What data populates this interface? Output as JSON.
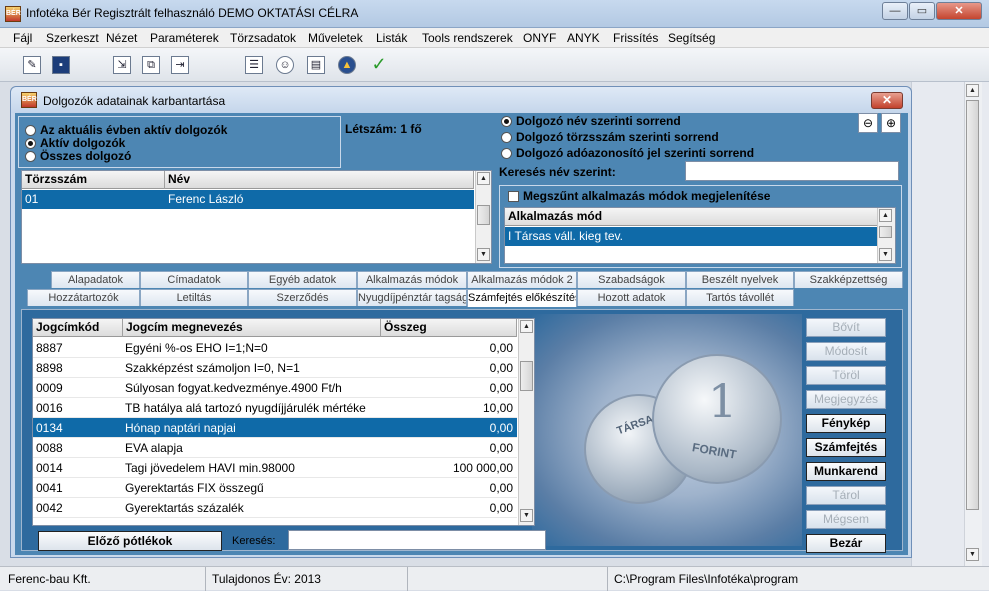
{
  "app": {
    "title": "Infotéka Bér Regisztrált felhasználó DEMO OKTATÁSI CÉLRA",
    "icon_text": "BÉR"
  },
  "menu": [
    "Fájl",
    "Szerkeszt",
    "Nézet",
    "Paraméterek",
    "Törzsadatok",
    "Műveletek",
    "Listák",
    "Tools rendszerek",
    "ONYF",
    "ANYK",
    "Frissítés",
    "Segítség"
  ],
  "dialog": {
    "title": "Dolgozók adatainak karbantartása",
    "filter": {
      "options": [
        "Az aktuális évben aktív dolgozók",
        "Aktív dolgozók",
        "Összes dolgozó"
      ],
      "selected": 1
    },
    "headcount": "Létszám: 1 fő",
    "sort": {
      "options": [
        "Dolgozó név szerinti sorrend",
        "Dolgozó törzsszám szerinti sorrend",
        "Dolgozó adóazonosító jel szerinti sorrend"
      ],
      "selected": 0
    },
    "search_name_label": "Keresés név szerint:",
    "search_name_value": "",
    "employees": {
      "headers": [
        "Törzsszám",
        "Név"
      ],
      "rows": [
        [
          "01",
          "Ferenc László"
        ]
      ]
    },
    "employment": {
      "checkbox_label": "Megszűnt alkalmazás módok megjelenítése",
      "header": "Alkalmazás mód",
      "rows": [
        "I Társas váll. kieg tev."
      ]
    },
    "tabs_row1": [
      "Alapadatok",
      "Címadatok",
      "Egyéb adatok",
      "Alkalmazás módok",
      "Alkalmazás módok 2",
      "Szabadságok",
      "Beszélt nyelvek",
      "Szakképzettség"
    ],
    "tabs_row2": [
      "Hozzátartozók",
      "Letiltás",
      "Szerződés",
      "Nyugdíjpénztár tagság",
      "Számfejtés előkészítés",
      "Hozott adatok",
      "Tartós távollét"
    ],
    "active_tab": "Számfejtés előkészítés",
    "codes": {
      "headers": [
        "Jogcímkód",
        "Jogcím megnevezés",
        "Összeg"
      ],
      "rows": [
        [
          "8887",
          "Egyéni %-os EHO I=1;N=0",
          "0,00"
        ],
        [
          "8898",
          "Szakképzést számoljon I=0, N=1",
          "0,00"
        ],
        [
          "0009",
          "Súlyosan fogyat.kedvezménye.4900 Ft/h",
          "0,00"
        ],
        [
          "0016",
          "TB hatálya alá tartozó nyugdíjjárulék mértéke",
          "10,00"
        ],
        [
          "0134",
          "Hónap naptári napjai",
          "0,00"
        ],
        [
          "0088",
          "EVA alapja",
          "0,00"
        ],
        [
          "0014",
          "Tagi jövedelem  HAVI min.98000",
          "100 000,00"
        ],
        [
          "0041",
          "Gyerektartás FIX összegű",
          "0,00"
        ],
        [
          "0042",
          "Gyerektartás százalék",
          "0,00"
        ]
      ],
      "selected_index": 4
    },
    "prev_button": "Előző pótlékok",
    "search_label": "Keresés:",
    "search_value": "",
    "buttons": [
      {
        "label": "Bővít",
        "enabled": false
      },
      {
        "label": "Módosít",
        "enabled": false
      },
      {
        "label": "Töröl",
        "enabled": false
      },
      {
        "label": "Megjegyzés",
        "enabled": false
      },
      {
        "label": "Fénykép",
        "enabled": true
      },
      {
        "label": "Számfejtés",
        "enabled": true
      },
      {
        "label": "Munkarend",
        "enabled": true
      },
      {
        "label": "Tárol",
        "enabled": false
      },
      {
        "label": "Mégsem",
        "enabled": false
      },
      {
        "label": "Bezár",
        "enabled": true
      }
    ],
    "coin_text": [
      "TÁRSAS",
      "FORINT"
    ]
  },
  "status": [
    "Ferenc-bau Kft.",
    "Tulajdonos Év: 2013",
    "",
    "C:\\Program Files\\Infotéka\\program"
  ]
}
